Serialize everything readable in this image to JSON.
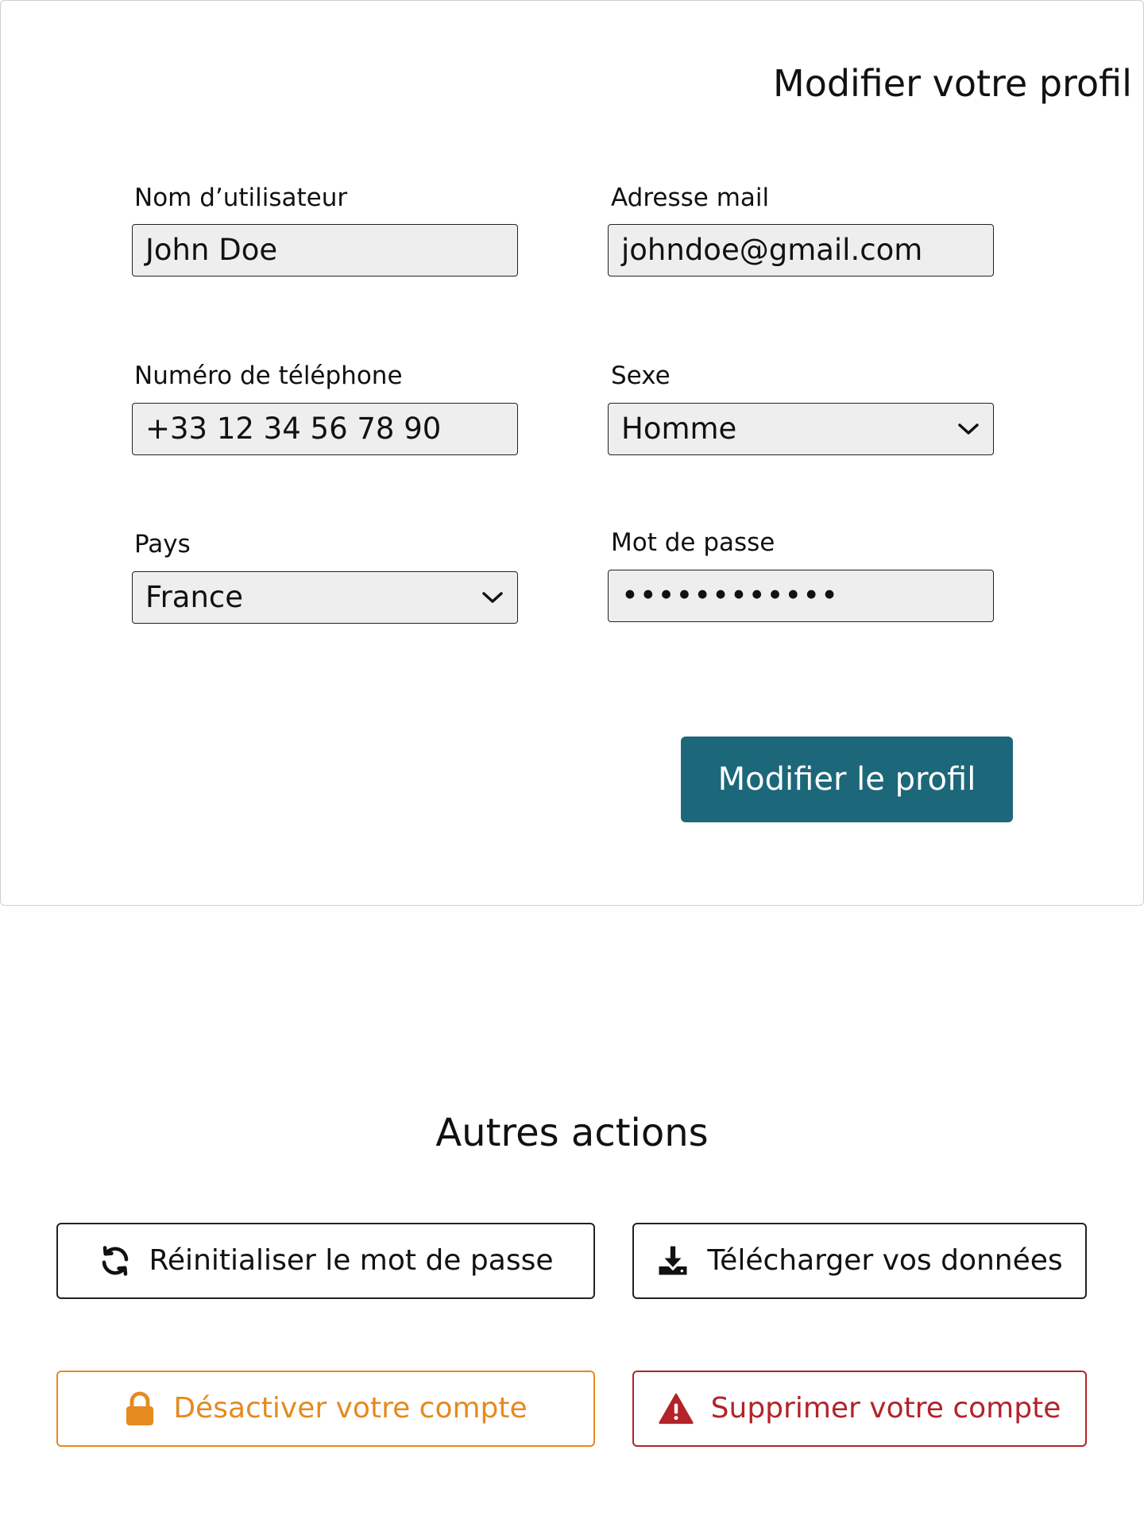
{
  "profile": {
    "title": "Modifier votre profil",
    "fields": {
      "username": {
        "label": "Nom d’utilisateur",
        "value": "John Doe"
      },
      "email": {
        "label": "Adresse mail",
        "value": "johndoe@gmail.com"
      },
      "phone": {
        "label": "Numéro de téléphone",
        "value": "+33 12 34 56 78 90"
      },
      "gender": {
        "label": "Sexe",
        "value": "Homme"
      },
      "country": {
        "label": "Pays",
        "value": "France"
      },
      "password": {
        "label": "Mot de passe",
        "value": "••••••••••••"
      }
    },
    "submit_label": "Modifier le profil"
  },
  "other_actions": {
    "title": "Autres actions",
    "reset_password": {
      "label": "Réinitialiser le mot de passe",
      "icon": "refresh-icon"
    },
    "download_data": {
      "label": "Télécharger vos données",
      "icon": "download-icon"
    },
    "deactivate": {
      "label": "Désactiver votre compte",
      "icon": "lock-icon",
      "color": "#e58a1f"
    },
    "delete": {
      "label": "Supprimer votre compte",
      "icon": "warning-icon",
      "color": "#b3232a"
    }
  },
  "colors": {
    "primary": "#1d677a",
    "field_background": "#eeeeee"
  }
}
